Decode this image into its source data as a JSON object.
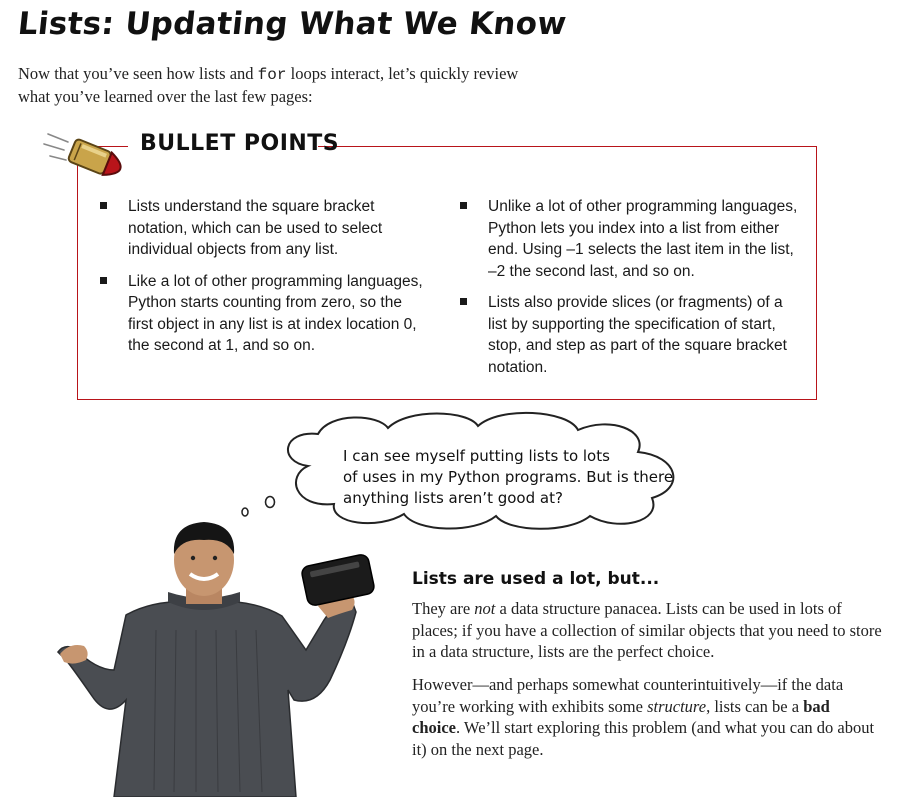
{
  "page": {
    "title": "Lists: Updating What We Know",
    "intro": {
      "line1_before": "Now that you’ve seen how lists and ",
      "line1_code": "for",
      "line1_after": " loops interact, let’s quickly review",
      "line2": "what you’ve learned over the last few pages:"
    }
  },
  "bullet_points": {
    "heading": "BULLET POINTS",
    "left": [
      "Lists understand the square bracket notation, which can be used to select individual objects from any list.",
      "Like a lot of other programming languages, Python starts counting from zero, so the first object in any list is at index location 0, the second at 1, and so on."
    ],
    "right": [
      "Unlike a lot of other programming languages, Python lets you index into a list from either end. Using –1 selects the last item in the list, –2 the second last, and so on.",
      "Lists also provide slices (or fragments) of a list by supporting the specification of start, stop, and step as part of the square bracket notation."
    ]
  },
  "thought_bubble": {
    "line1": "I can see myself putting lists to lots",
    "line2": "of uses in my Python programs. But is there",
    "line3": "anything lists aren’t good at?"
  },
  "sidebar": {
    "heading": "Lists are used a lot, but...",
    "p1_before": "They are ",
    "p1_em": "not",
    "p1_after": " a data structure panacea. Lists can be used in lots of places; if you have a collection of similar objects that you need to store in a data structure, lists are the perfect choice.",
    "p2_a": "However—and perhaps somewhat counterintuitively—if the data you’re working with exhibits some ",
    "p2_em": "structure",
    "p2_b": ", lists can be a ",
    "p2_strong": "bad choice",
    "p2_c": ". We’ll start exploring this problem (and what you can do about it) on the next page."
  },
  "colors": {
    "box_border": "#b8141a",
    "bullet_body": "#c9a44a",
    "bullet_tip": "#b8141a"
  }
}
